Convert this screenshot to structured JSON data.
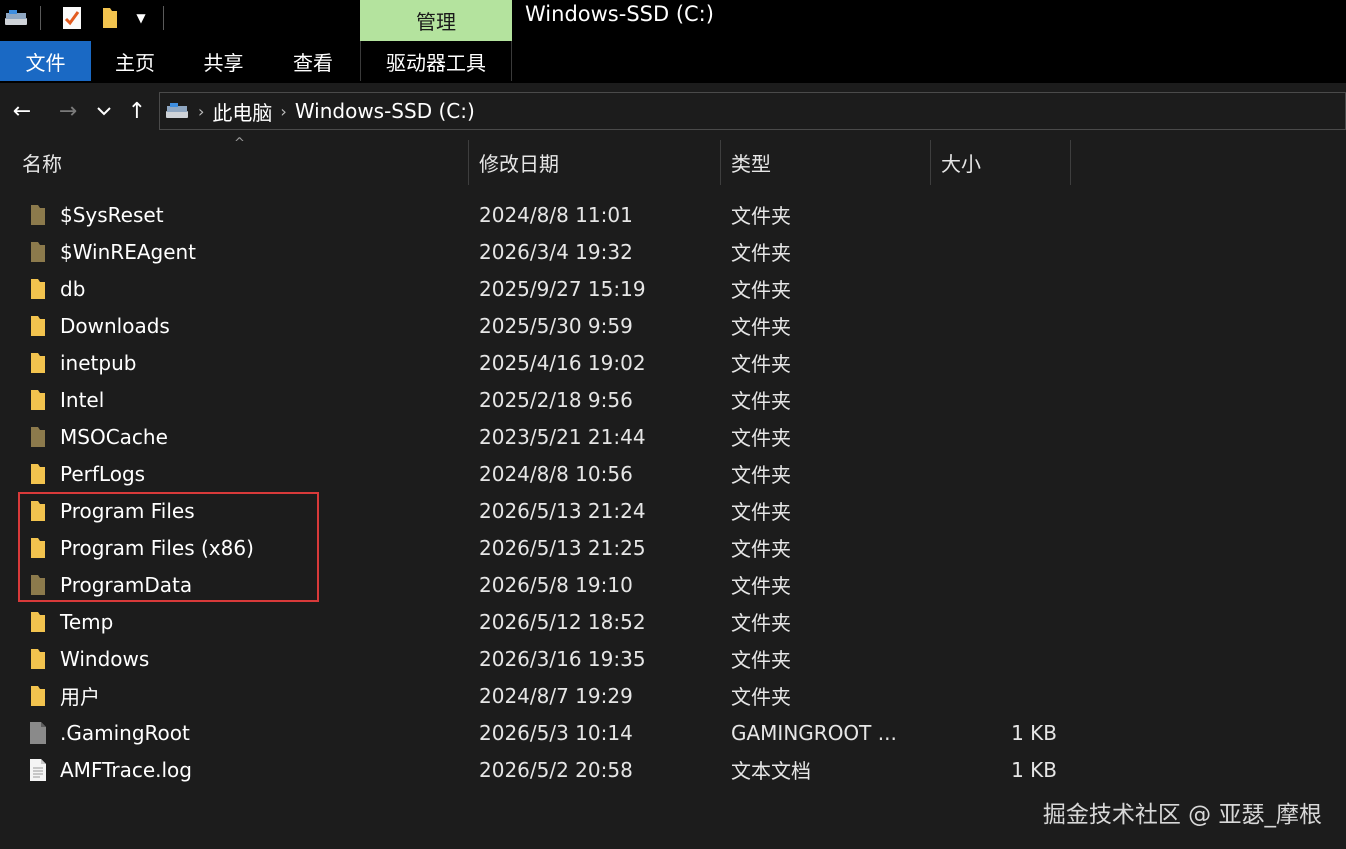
{
  "window": {
    "title": "Windows-SSD (C:)",
    "context_tab": "管理"
  },
  "ribbon": {
    "tabs": [
      {
        "label": "文件",
        "active": true
      },
      {
        "label": "主页"
      },
      {
        "label": "共享"
      },
      {
        "label": "查看"
      },
      {
        "label": "驱动器工具"
      }
    ]
  },
  "address": {
    "icon": "drive-icon",
    "crumbs": [
      "此电脑",
      "Windows-SSD (C:)"
    ]
  },
  "columns": {
    "name": "名称",
    "modified": "修改日期",
    "type": "类型",
    "size": "大小"
  },
  "files": [
    {
      "name": "$SysReset",
      "modified": "2024/8/8 11:01",
      "type": "文件夹",
      "size": "",
      "icon": "folder-hidden-icon"
    },
    {
      "name": "$WinREAgent",
      "modified": "2026/3/4 19:32",
      "type": "文件夹",
      "size": "",
      "icon": "folder-hidden-icon"
    },
    {
      "name": "db",
      "modified": "2025/9/27 15:19",
      "type": "文件夹",
      "size": "",
      "icon": "folder-icon"
    },
    {
      "name": "Downloads",
      "modified": "2025/5/30 9:59",
      "type": "文件夹",
      "size": "",
      "icon": "folder-icon"
    },
    {
      "name": "inetpub",
      "modified": "2025/4/16 19:02",
      "type": "文件夹",
      "size": "",
      "icon": "folder-icon"
    },
    {
      "name": "Intel",
      "modified": "2025/2/18 9:56",
      "type": "文件夹",
      "size": "",
      "icon": "folder-icon"
    },
    {
      "name": "MSOCache",
      "modified": "2023/5/21 21:44",
      "type": "文件夹",
      "size": "",
      "icon": "folder-hidden-icon"
    },
    {
      "name": "PerfLogs",
      "modified": "2024/8/8 10:56",
      "type": "文件夹",
      "size": "",
      "icon": "folder-icon"
    },
    {
      "name": "Program Files",
      "modified": "2026/5/13 21:24",
      "type": "文件夹",
      "size": "",
      "icon": "folder-icon"
    },
    {
      "name": "Program Files (x86)",
      "modified": "2026/5/13 21:25",
      "type": "文件夹",
      "size": "",
      "icon": "folder-icon"
    },
    {
      "name": "ProgramData",
      "modified": "2026/5/8 19:10",
      "type": "文件夹",
      "size": "",
      "icon": "folder-hidden-icon"
    },
    {
      "name": "Temp",
      "modified": "2026/5/12 18:52",
      "type": "文件夹",
      "size": "",
      "icon": "folder-icon"
    },
    {
      "name": "Windows",
      "modified": "2026/3/16 19:35",
      "type": "文件夹",
      "size": "",
      "icon": "folder-icon"
    },
    {
      "name": "用户",
      "modified": "2024/8/7 19:29",
      "type": "文件夹",
      "size": "",
      "icon": "folder-icon"
    },
    {
      "name": ".GamingRoot",
      "modified": "2026/5/3 10:14",
      "type": "GAMINGROOT ...",
      "size": "1 KB",
      "icon": "file-hidden-icon"
    },
    {
      "name": "AMFTrace.log",
      "modified": "2026/5/2 20:58",
      "type": "文本文档",
      "size": "1 KB",
      "icon": "text-file-icon"
    }
  ],
  "watermark": "掘金技术社区 @ 亚瑟_摩根",
  "colors": {
    "accent": "#1a69c4",
    "context_tab": "#b4e39e",
    "folder": "#f2c34e",
    "folder_hidden": "#8c7a4c",
    "highlight": "#d83a3a"
  }
}
